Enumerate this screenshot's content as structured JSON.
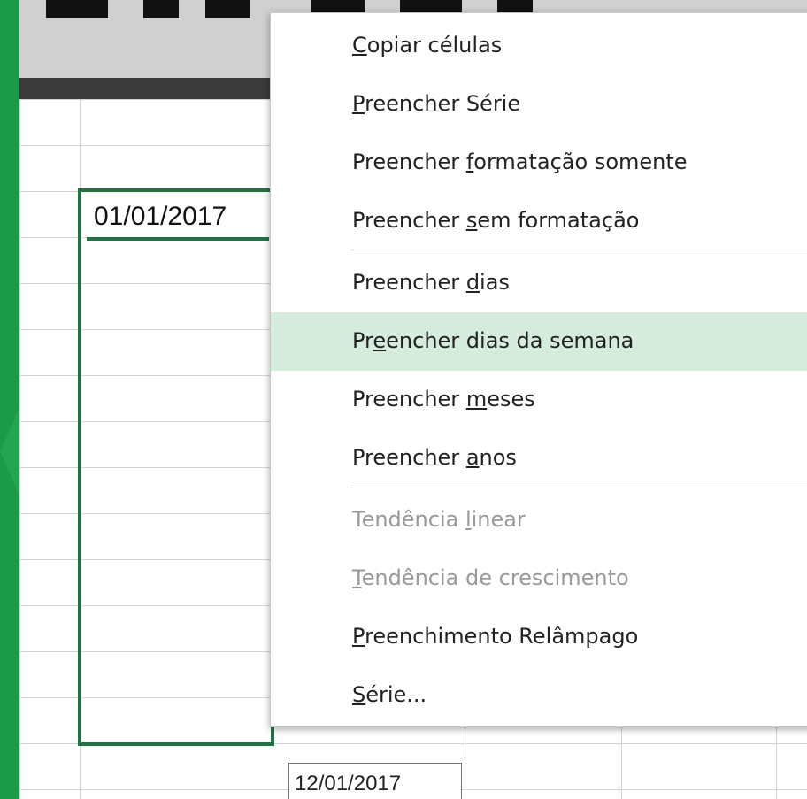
{
  "sheet": {
    "cell_value": "01/01/2017",
    "tooltip": "12/01/2017"
  },
  "menu": {
    "items": [
      {
        "label_before": "",
        "accel": "C",
        "label_after": "opiar células",
        "disabled": false
      },
      {
        "label_before": "",
        "accel": "P",
        "label_after": "reencher Série",
        "disabled": false
      },
      {
        "label_before": "Preencher ",
        "accel": "f",
        "label_after": "ormatação somente",
        "disabled": false
      },
      {
        "label_before": "Preencher ",
        "accel": "s",
        "label_after": "em formatação",
        "disabled": false
      },
      {
        "label_before": "Preencher ",
        "accel": "d",
        "label_after": "ias",
        "disabled": false
      },
      {
        "label_before": "Pr",
        "accel": "e",
        "label_after": "encher dias da semana",
        "disabled": false,
        "highlighted": true
      },
      {
        "label_before": "Preencher ",
        "accel": "m",
        "label_after": "eses",
        "disabled": false
      },
      {
        "label_before": "Preencher ",
        "accel": "a",
        "label_after": "nos",
        "disabled": false
      },
      {
        "label_before": "Tendência ",
        "accel": "l",
        "label_after": "inear",
        "disabled": true
      },
      {
        "label_before": "",
        "accel": "T",
        "label_after": "endência de crescimento",
        "disabled": true
      },
      {
        "label_before": "",
        "accel": "P",
        "label_after": "reenchimento Relâmpago",
        "disabled": false
      },
      {
        "label_before": "",
        "accel": "S",
        "label_after": "érie...",
        "disabled": false
      }
    ]
  },
  "colors": {
    "accent": "#217346",
    "highlight": "#d5ecdd",
    "frame_green": "#1b9a47"
  }
}
